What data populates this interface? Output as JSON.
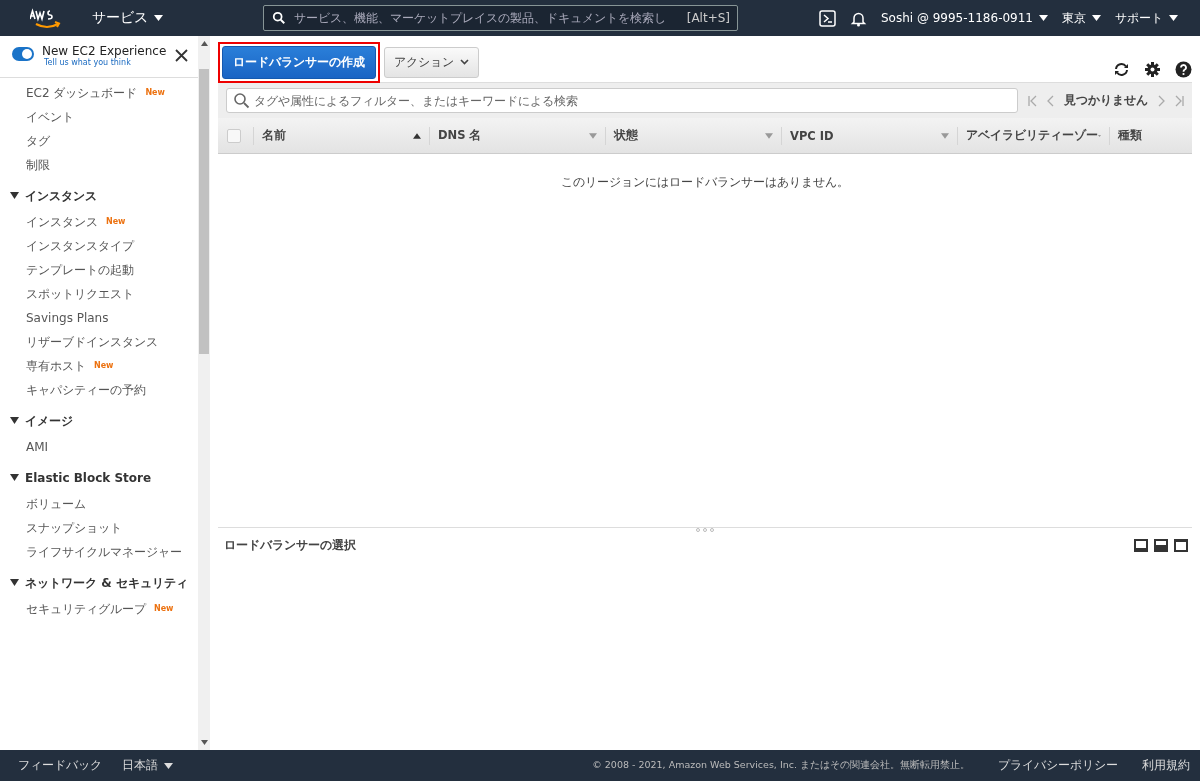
{
  "top_nav": {
    "services": "サービス",
    "search": {
      "placeholder": "サービス、機能、マーケットプレイスの製品、ドキュメントを検索し",
      "shortcut": "[Alt+S]"
    },
    "account": "Soshi @ 9995-1186-0911",
    "region": "東京",
    "support": "サポート"
  },
  "sidebar": {
    "experience": {
      "title": "New EC2 Experience",
      "link": "Tell us what you think",
      "on": true
    },
    "items": [
      {
        "label": "EC2 ダッシュボード",
        "badge": "New"
      },
      {
        "label": "イベント"
      },
      {
        "label": "タグ"
      },
      {
        "label": "制限"
      }
    ],
    "groups": [
      {
        "title": "インスタンス",
        "expanded": true,
        "items": [
          {
            "label": "インスタンス",
            "badge": "New"
          },
          {
            "label": "インスタンスタイプ"
          },
          {
            "label": "テンプレートの起動"
          },
          {
            "label": "スポットリクエスト"
          },
          {
            "label": "Savings Plans"
          },
          {
            "label": "リザーブドインスタンス"
          },
          {
            "label": "専有ホスト",
            "badge": "New"
          },
          {
            "label": "キャパシティーの予約"
          }
        ]
      },
      {
        "title": "イメージ",
        "expanded": true,
        "items": [
          {
            "label": "AMI"
          }
        ]
      },
      {
        "title": "Elastic Block Store",
        "expanded": true,
        "items": [
          {
            "label": "ボリューム"
          },
          {
            "label": "スナップショット"
          },
          {
            "label": "ライフサイクルマネージャー"
          }
        ]
      },
      {
        "title": "ネットワーク & セキュリティ",
        "expanded": true,
        "items": [
          {
            "label": "セキュリティグループ",
            "badge": "New"
          }
        ]
      }
    ]
  },
  "toolbar": {
    "create_button": "ロードバランサーの作成",
    "actions_button": "アクション"
  },
  "filter": {
    "placeholder": "タグや属性によるフィルター、またはキーワードによる検索",
    "pager": "見つかりません"
  },
  "table": {
    "select_all": {
      "checked": false
    },
    "columns": [
      {
        "label": "名前",
        "sorted": true
      },
      {
        "label": "DNS 名",
        "sorted": false
      },
      {
        "label": "状態",
        "sorted": false
      },
      {
        "label": "VPC ID",
        "sorted": false
      },
      {
        "label": "アベイラビリティーゾー",
        "sorted": false
      },
      {
        "label": "種類",
        "sorted": false
      }
    ],
    "empty_message": "このリージョンにはロードバランサーはありません。"
  },
  "detail": {
    "title": "ロードバランサーの選択"
  },
  "footer": {
    "feedback": "フィードバック",
    "language": "日本語",
    "copyright": "© 2008 - 2021, Amazon Web Services, Inc. またはその関連会社。無断転用禁止。",
    "privacy": "プライバシーポリシー",
    "terms": "利用規約"
  }
}
